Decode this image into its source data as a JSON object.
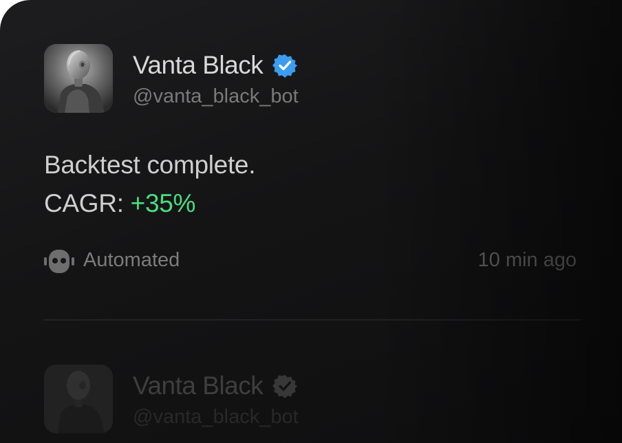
{
  "posts": [
    {
      "name": "Vanta Black",
      "handle": "@vanta_black_bot",
      "verified": true,
      "body_line1": "Backtest complete.",
      "metric_label": "CAGR:",
      "metric_value": "+35%",
      "tag": "Automated",
      "tag_icon": "robot-icon",
      "time": "10 min ago"
    },
    {
      "name": "Vanta Black",
      "handle": "@vanta_black_bot",
      "verified": true
    }
  ],
  "colors": {
    "background": "#161617",
    "name_text": "#d8d8d8",
    "muted_text": "#7a7a7a",
    "positive": "#4ade80",
    "verified_badge": "#3b9cf0"
  }
}
